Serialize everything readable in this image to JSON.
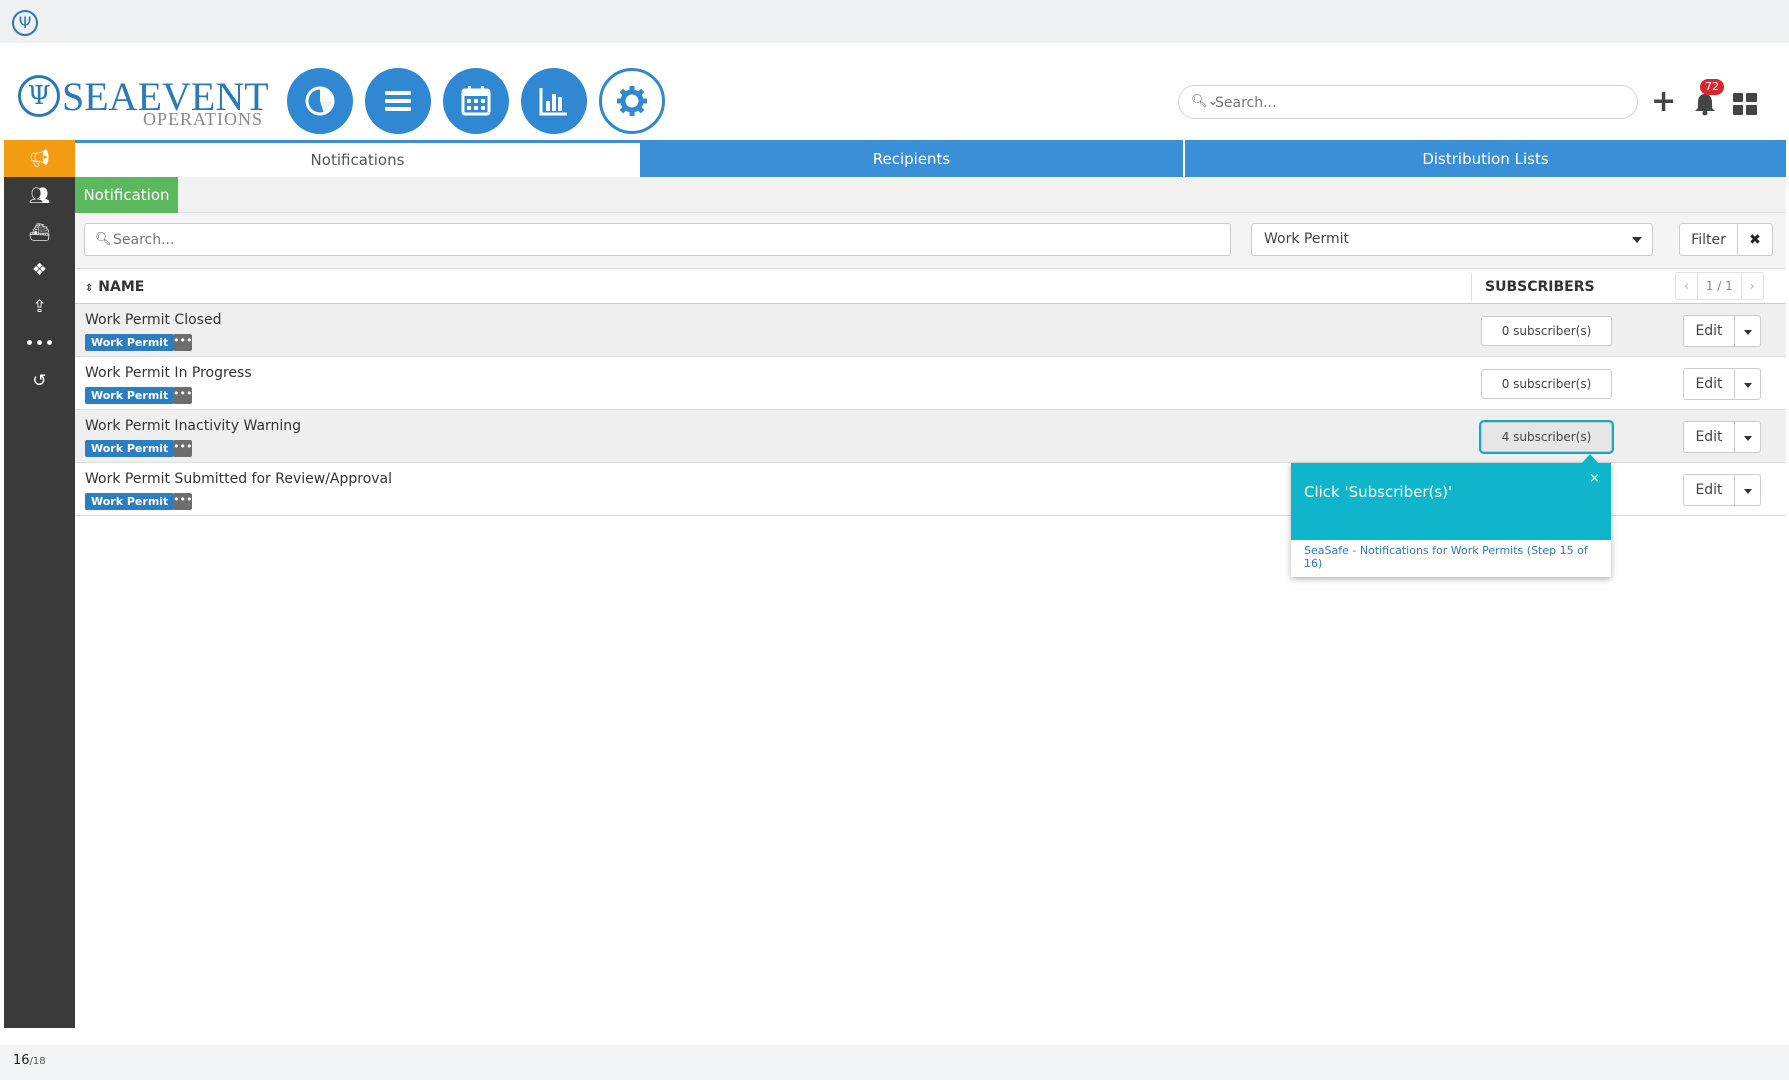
{
  "header": {
    "brand_word1": "SEAEVENT",
    "brand_word2": "OPERATIONS",
    "search_placeholder": "Search...",
    "notification_count": "72",
    "nav_icons": [
      "pie-chart-icon",
      "list-icon",
      "calendar-icon",
      "bar-chart-icon",
      "gear-icon"
    ],
    "accent_color": "#2f88d1"
  },
  "sidebar": {
    "items": [
      "megaphone-icon",
      "users-icon",
      "ship-icon",
      "cubes-icon",
      "upload-icon",
      "ellipsis-icon",
      "history-icon"
    ],
    "active_color": "#f39c12"
  },
  "tabs": [
    {
      "label": "Notifications"
    },
    {
      "label": "Recipients"
    },
    {
      "label": "Distribution Lists"
    }
  ],
  "subtab": {
    "label": "Notification"
  },
  "filters": {
    "search_placeholder": "Search...",
    "type_value": "Work Permit",
    "filter_label": "Filter",
    "clear_label": "✖"
  },
  "table": {
    "col_name": "NAME",
    "col_subscribers": "SUBSCRIBERS",
    "pager": {
      "prev": "‹",
      "page": "1 / 1",
      "next": "›"
    },
    "rows": [
      {
        "name": "Work Permit Closed",
        "tag": "Work Permit",
        "subscribers": "0 subscriber(s)",
        "edit": "Edit"
      },
      {
        "name": "Work Permit In Progress",
        "tag": "Work Permit",
        "subscribers": "0 subscriber(s)",
        "edit": "Edit"
      },
      {
        "name": "Work Permit Inactivity Warning",
        "tag": "Work Permit",
        "subscribers": "4 subscriber(s)",
        "edit": "Edit"
      },
      {
        "name": "Work Permit Submitted for Review/Approval",
        "tag": "Work Permit",
        "subscribers": "",
        "edit": "Edit"
      }
    ]
  },
  "tooltip": {
    "title": "Click 'Subscriber(s)'",
    "close": "×",
    "link": "SeaSafe - Notifications for Work Permits (Step 15 of 16)",
    "color": "#10b5cc"
  },
  "footer": {
    "step": "16",
    "total": "/18"
  }
}
